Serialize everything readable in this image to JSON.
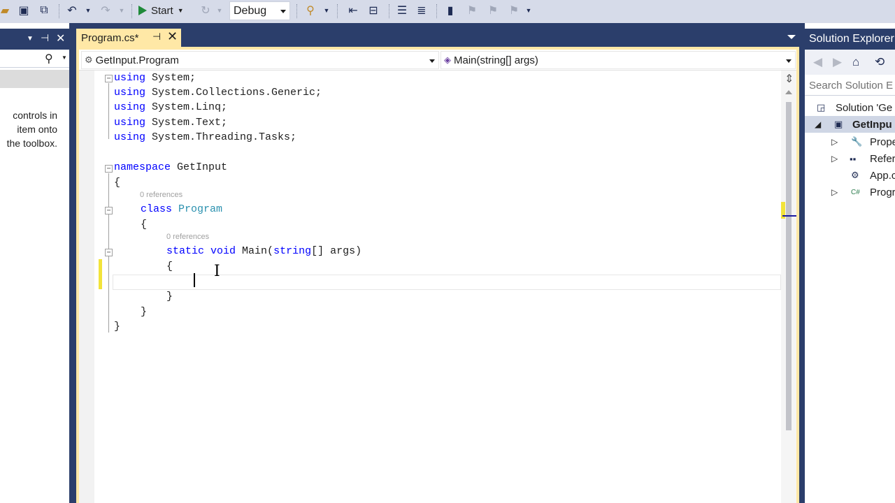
{
  "toolbar": {
    "start_label": "Start",
    "config_value": "Debug"
  },
  "toolbox": {
    "hint": "controls in\nitem onto\nthe toolbox."
  },
  "editor": {
    "tab_label": "Program.cs*",
    "nav_left": "GetInput.Program",
    "nav_right": "Main(string[] args)",
    "code": {
      "line1_kw": "using",
      "line1_rest": " System;",
      "line2_kw": "using",
      "line2_rest": " System.Collections.Generic;",
      "line3_kw": "using",
      "line3_rest": " System.Linq;",
      "line4_kw": "using",
      "line4_rest": " System.Text;",
      "line5_kw": "using",
      "line5_rest": " System.Threading.Tasks;",
      "ns_kw": "namespace",
      "ns_name": " GetInput",
      "open_brace": "{",
      "close_brace": "}",
      "class_refs": "0 references",
      "class_kw": "class",
      "class_name": "Program",
      "method_refs": "0 references",
      "static_kw": "static",
      "void_kw": "void",
      "method_name": " Main(",
      "string_kw": "string",
      "method_params": "[] args)"
    }
  },
  "solution_explorer": {
    "title": "Solution Explorer",
    "search_placeholder": "Search Solution E",
    "items": [
      {
        "label": "Solution 'Ge"
      },
      {
        "label": "GetInpu"
      },
      {
        "label": "Prope"
      },
      {
        "label": "Refer"
      },
      {
        "label": "App.c"
      },
      {
        "label": "Progr"
      }
    ],
    "csharp_badge": "C#"
  },
  "colors": {
    "keyword": "#0000ff",
    "type": "#2b91af",
    "frame": "#2b3e6b",
    "active_tab": "#ffe8a6",
    "change_marker": "#f2e33a"
  }
}
